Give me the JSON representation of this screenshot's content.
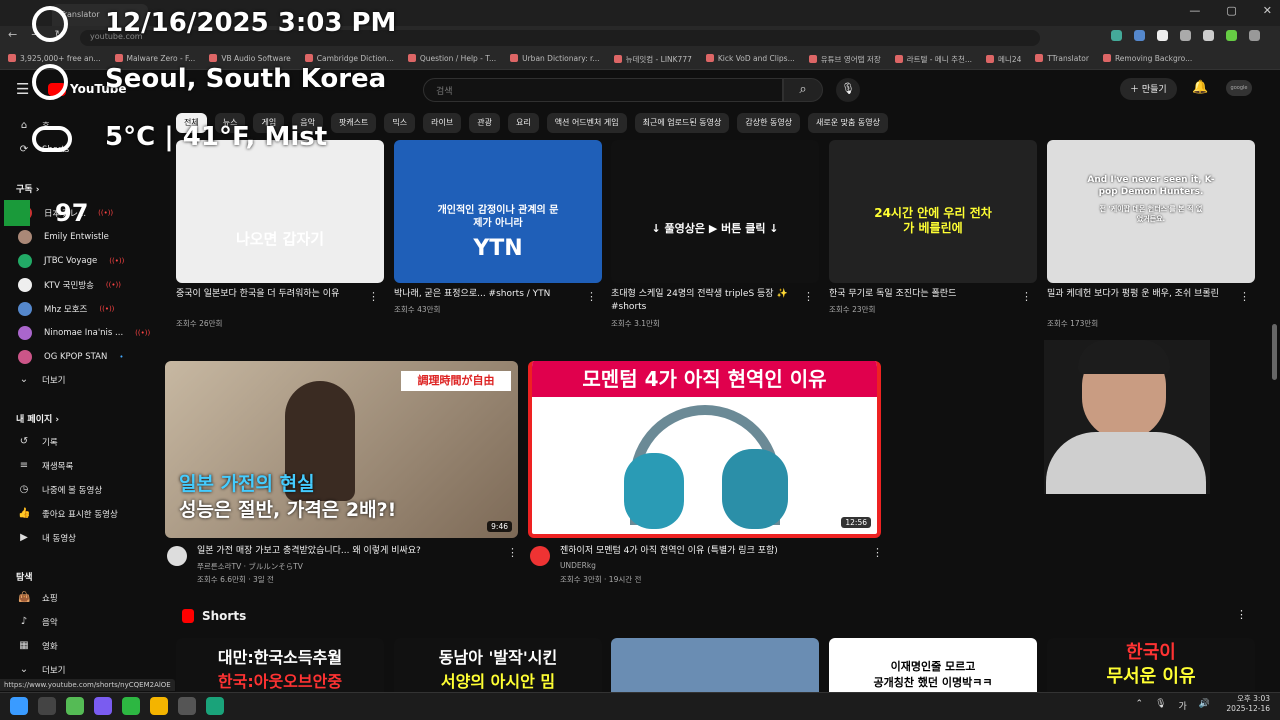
{
  "browser": {
    "tab_title": "Translator",
    "url": "youtube.com",
    "window_controls": [
      "—",
      "▢",
      "✕"
    ],
    "bookmarks": [
      "3,925,000+ free an...",
      "Malware Zero - F...",
      "VB Audio Software",
      "Cambridge Diction...",
      "Question / Help - T...",
      "Urban Dictionary: r...",
      "뉴데잇컴 - LINK777",
      "Kick VoD and Clips...",
      "유튜브 영어탭 저장",
      "라트텔 - 메니 추천...",
      "메니24",
      "TTranslator",
      "Removing Backgro..."
    ],
    "status_url": "https://www.youtube.com/shorts/nyCQEM2AlOE"
  },
  "overlay": {
    "datetime": "12/16/2025 3:03 PM",
    "location": "Seoul, South Korea",
    "weather": "5°C | 41°F, Mist",
    "battery": "97"
  },
  "youtube": {
    "logo": "YouTube",
    "search_placeholder": "검색",
    "create_label": "만들기",
    "account_label": "google",
    "chips": [
      "전체",
      "뉴스",
      "게임",
      "음악",
      "팟캐스트",
      "믹스",
      "라이브",
      "관광",
      "요리",
      "액션 어드벤처 게임",
      "최근에 업로드된 동영상",
      "감상한 동영상",
      "새로운 맞춤 동영상"
    ],
    "sidebar": {
      "home": "홈",
      "shorts": "Shorts",
      "subscriptions": "구독",
      "channels": [
        {
          "name": "日本テレ...",
          "color": "#c33"
        },
        {
          "name": "Emily Entwistle",
          "color": "#a87"
        },
        {
          "name": "JTBC Voyage",
          "color": "#2a6"
        },
        {
          "name": "KTV 국민방송",
          "color": "#eee"
        },
        {
          "name": "Mhz 모호즈",
          "color": "#58c"
        },
        {
          "name": "Ninomae Ina'nis ...",
          "color": "#a6c"
        },
        {
          "name": "OG KPOP STAN",
          "color": "#c58"
        }
      ],
      "more": "더보기",
      "my_page": "내 페이지",
      "my_items": [
        "기록",
        "재생목록",
        "나중에 볼 동영상",
        "좋아요 표시한 동영상",
        "내 동영상"
      ],
      "explore": "탐색",
      "explore_items": [
        "쇼핑",
        "음악",
        "영화",
        "더보기"
      ]
    },
    "top_row": [
      {
        "title": "중국이 일본보다 한국을 더 두려워하는 이유",
        "meta": "조회수 26만회",
        "thumb_text": "나오면 갑자기",
        "bg": "#eee",
        "fg": "#fff"
      },
      {
        "title": "박나래, 굳은 표정으로... #shorts / YTN",
        "meta": "조회수 43만회",
        "thumb_text": "개인적인 감정이나 관계의 문제가 아니라",
        "brand": "YTN",
        "bg": "#1f5fb8",
        "fg": "#fff"
      },
      {
        "title": "초대형 스케일 24명의 전략생 tripleS 등장 ✨ #shorts",
        "meta": "조회수 3.1만회",
        "thumb_text": "↓ 풀영상은 ▶ 버튼 클릭 ↓",
        "bg": "#111",
        "fg": "#fff"
      },
      {
        "title": "한국 무기로 독일 조진다는 폴란드",
        "meta": "조회수 23만회",
        "thumb_text": "24시간 안에 우리 전차가 베를린에",
        "bg": "#222",
        "fg": "#ff3"
      },
      {
        "title": "밀과 케데헌 보다가 펑펑 운 배우, 조쉬 브롤린",
        "meta": "조회수 173만회",
        "thumb_text": "And I've never seen it, K-pop Demon Hunters.",
        "sub_text": "전 '케이팝 데몬 헌터스'를 본 적 없었거든요.",
        "bg": "#ddd",
        "fg": "#fff"
      }
    ],
    "mid_row": [
      {
        "title": "일본 가전 매장 가보고 충격받았습니다... 왜 이렇게 비싸요?",
        "channel": "쭈르른소라TV · ブルルンそらTV",
        "meta": "조회수 6.6만회 · 3일 전",
        "duration": "9:46",
        "line1": "일본 가전의 현실",
        "line2": "성능은 절반, 가격은 2배?!",
        "label_jp": "調理時間が自由"
      },
      {
        "title": "젠하이저 모멘텀 4가 아직 현역인 이유 (특별가 링크 포함)",
        "channel": "UNDERkg",
        "meta": "조회수 3만회 · 19시간 전",
        "duration": "12:56",
        "banner": "모멘텀 4가 아직 현역인 이유"
      }
    ],
    "shorts_label": "Shorts",
    "shorts": [
      {
        "text1": "대만:한국소득추월",
        "text2": "한국:아웃오브안중",
        "bg": "#111",
        "c1": "#fff",
        "c2": "#f33"
      },
      {
        "text1": "동남아 '발작'시킨",
        "text2": "서양의 아시안 밈",
        "bg": "#111",
        "c1": "#fff",
        "c2": "#ff3"
      },
      {
        "text1": "",
        "text2": "",
        "bg": "#6a8db3",
        "c1": "#fff",
        "c2": "#fff"
      },
      {
        "text1": "이재명인줄 모르고",
        "text2": "공개칭찬 했던 이명박ㅋㅋ",
        "bg": "#fff",
        "c1": "#000",
        "c2": "#000"
      },
      {
        "text1": "한국이",
        "text2": "무서운 이유",
        "bg": "#111",
        "c1": "#f33",
        "c2": "#ff3"
      }
    ]
  },
  "taskbar": {
    "tray": [
      "⌃",
      "🎙",
      "가",
      "🔊"
    ],
    "time": "오후 3:03",
    "date": "2025-12-16"
  }
}
